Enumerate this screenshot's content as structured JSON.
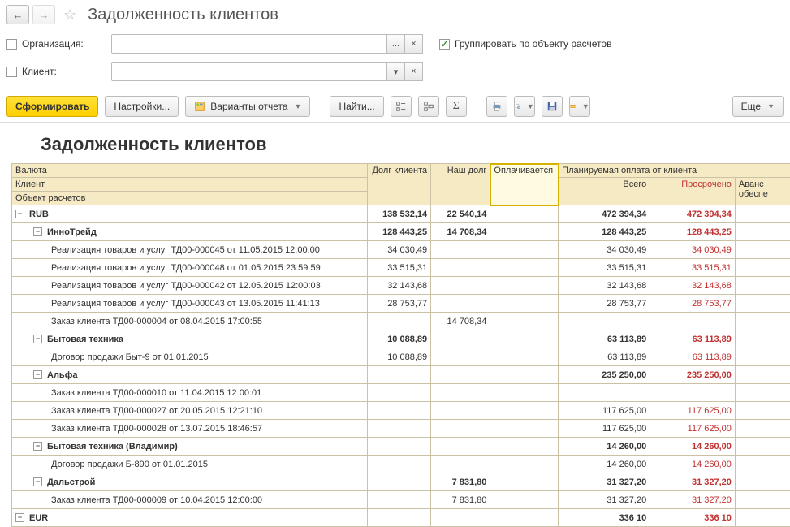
{
  "header": {
    "title": "Задолженность клиентов"
  },
  "filters": {
    "org_label": "Организация:",
    "client_label": "Клиент:",
    "group_label": "Группировать по объекту расчетов",
    "ellipsis": "...",
    "clear": "×",
    "drop": "▾"
  },
  "toolbar": {
    "form": "Сформировать",
    "settings": "Настройки...",
    "variants": "Варианты отчета",
    "find": "Найти...",
    "more": "Еще"
  },
  "report_title": "Задолженность клиентов",
  "headers": {
    "currency": "Валюта",
    "client": "Клиент",
    "object": "Объект расчетов",
    "debt_client": "Долг клиента",
    "our_debt": "Наш долг",
    "paying": "Оплачивается",
    "planned": "Планируемая оплата от клиента",
    "total": "Всего",
    "overdue": "Просрочено",
    "advance": "Аванс обеспе"
  },
  "rows": [
    {
      "lvl": 0,
      "bold": true,
      "label": "RUB",
      "a": "138 532,14",
      "b": "22 540,14",
      "d": "472 394,34",
      "e": "472 394,34"
    },
    {
      "lvl": 1,
      "bold": true,
      "label": "ИнноТрейд",
      "a": "128 443,25",
      "b": "14 708,34",
      "d": "128 443,25",
      "e": "128 443,25"
    },
    {
      "lvl": 2,
      "label": "Реализация товаров и услуг ТД00-000045 от 11.05.2015 12:00:00",
      "a": "34 030,49",
      "d": "34 030,49",
      "e": "34 030,49"
    },
    {
      "lvl": 2,
      "label": "Реализация товаров и услуг ТД00-000048 от 01.05.2015 23:59:59",
      "a": "33 515,31",
      "d": "33 515,31",
      "e": "33 515,31"
    },
    {
      "lvl": 2,
      "label": "Реализация товаров и услуг ТД00-000042 от 12.05.2015 12:00:03",
      "a": "32 143,68",
      "d": "32 143,68",
      "e": "32 143,68"
    },
    {
      "lvl": 2,
      "label": "Реализация товаров и услуг ТД00-000043 от 13.05.2015 11:41:13",
      "a": "28 753,77",
      "d": "28 753,77",
      "e": "28 753,77"
    },
    {
      "lvl": 2,
      "label": "Заказ клиента ТД00-000004 от 08.04.2015 17:00:55",
      "b": "14 708,34"
    },
    {
      "lvl": 1,
      "bold": true,
      "label": "Бытовая техника",
      "a": "10 088,89",
      "d": "63 113,89",
      "e": "63 113,89"
    },
    {
      "lvl": 2,
      "label": "Договор продажи Быт-9 от 01.01.2015",
      "a": "10 088,89",
      "d": "63 113,89",
      "e": "63 113,89"
    },
    {
      "lvl": 1,
      "bold": true,
      "label": "Альфа",
      "d": "235 250,00",
      "e": "235 250,00"
    },
    {
      "lvl": 2,
      "label": "Заказ клиента ТД00-000010 от 11.04.2015 12:00:01"
    },
    {
      "lvl": 2,
      "label": "Заказ клиента ТД00-000027 от 20.05.2015 12:21:10",
      "d": "117 625,00",
      "e": "117 625,00"
    },
    {
      "lvl": 2,
      "label": "Заказ клиента ТД00-000028 от 13.07.2015 18:46:57",
      "d": "117 625,00",
      "e": "117 625,00"
    },
    {
      "lvl": 1,
      "bold": true,
      "label": "Бытовая техника (Владимир)",
      "d": "14 260,00",
      "e": "14 260,00"
    },
    {
      "lvl": 2,
      "label": "Договор продажи Б-890 от 01.01.2015",
      "d": "14 260,00",
      "e": "14 260,00"
    },
    {
      "lvl": 1,
      "bold": true,
      "label": "Дальстрой",
      "b": "7 831,80",
      "d": "31 327,20",
      "e": "31 327,20"
    },
    {
      "lvl": 2,
      "label": "Заказ клиента ТД00-000009 от 10.04.2015 12:00:00",
      "b": "7 831,80",
      "d": "31 327,20",
      "e": "31 327,20"
    },
    {
      "lvl": 0,
      "bold": true,
      "label": "EUR",
      "d": "336 10",
      "e": "336 10"
    }
  ]
}
